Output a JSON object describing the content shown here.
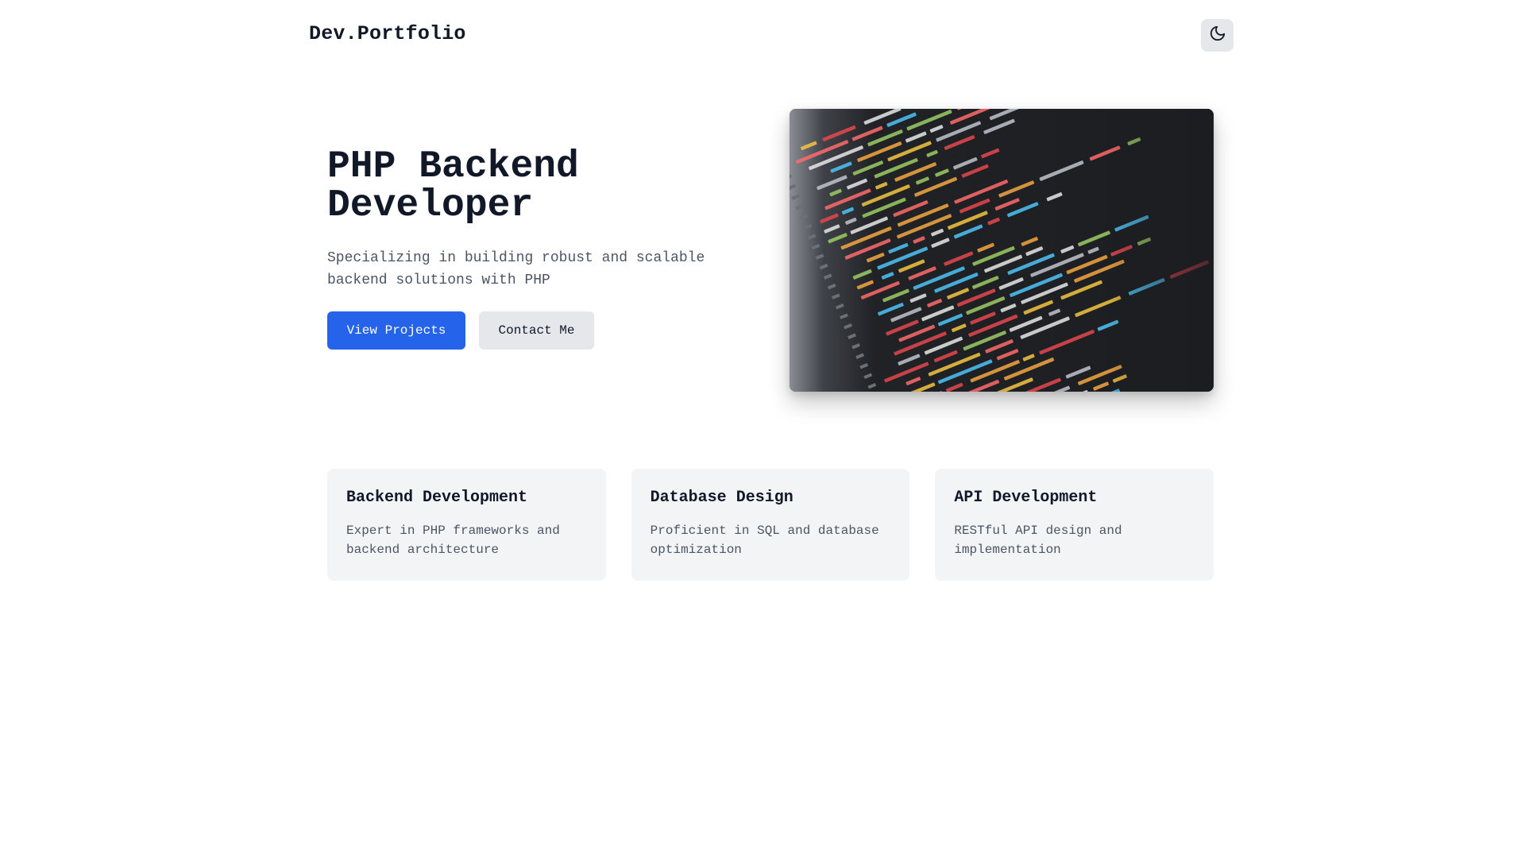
{
  "nav": {
    "brand": "Dev.Portfolio",
    "theme_toggle_icon": "moon-icon"
  },
  "hero": {
    "title_line1": "PHP Backend",
    "title_line2": "Developer",
    "subtitle": "Specializing in building robust and scalable backend solutions with PHP",
    "primary_button": "View Projects",
    "secondary_button": "Contact Me",
    "image_icon": "code-screen-image"
  },
  "cards": [
    {
      "title": "Backend Development",
      "description": "Expert in PHP frameworks and backend architecture"
    },
    {
      "title": "Database Design",
      "description": "Proficient in SQL and database optimization"
    },
    {
      "title": "API Development",
      "description": "RESTful API design and implementation"
    }
  ],
  "colors": {
    "primary": "#2563eb",
    "text": "#111827",
    "muted": "#4b5563",
    "card_bg": "#f3f4f6",
    "button_secondary_bg": "#e5e7eb"
  }
}
